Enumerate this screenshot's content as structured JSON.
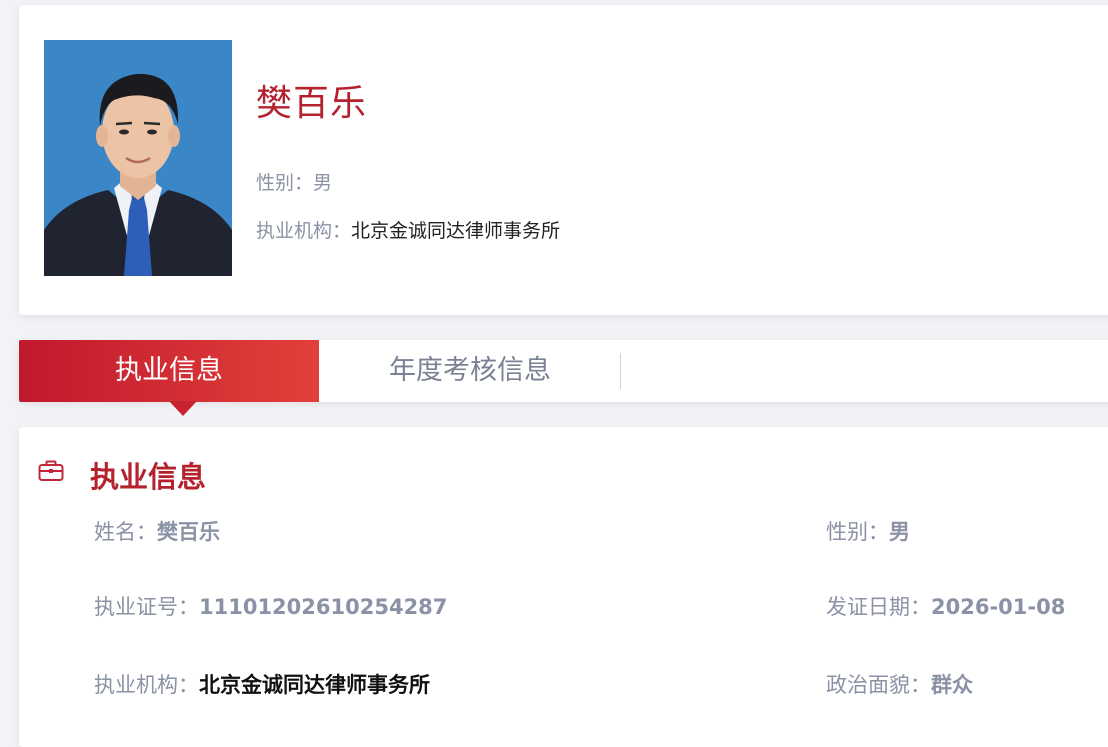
{
  "profile": {
    "name": "樊百乐",
    "gender_label": "性别：",
    "gender_value": "男",
    "org_label": "执业机构：",
    "org_value": "北京金诚同达律师事务所"
  },
  "tabs": [
    {
      "label": "执业信息",
      "active": true
    },
    {
      "label": "年度考核信息",
      "active": false
    }
  ],
  "section": {
    "title": "执业信息",
    "icon": "briefcase-icon"
  },
  "fields": {
    "name_label": "姓名：",
    "name_value": "樊百乐",
    "gender_label": "性别：",
    "gender_value": "男",
    "license_label": "执业证号：",
    "license_value": "11101202610254287",
    "date_label": "发证日期：",
    "date_value": "2026-01-08",
    "org_label": "执业机构：",
    "org_value": "北京金诚同达律师事务所",
    "politics_label": "政治面貌：",
    "politics_value": "群众"
  },
  "colors": {
    "accent": "#b4222e",
    "tab_gradient_start": "#c0192d",
    "tab_gradient_end": "#e2403a",
    "label_gray": "#8b92a5",
    "photo_background": "#3c88c8"
  }
}
